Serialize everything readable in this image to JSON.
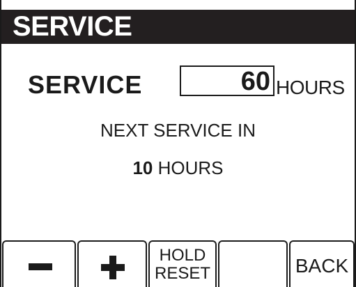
{
  "header": {
    "title": "SERVICE"
  },
  "setting": {
    "label": "SERVICE",
    "value": "60",
    "unit": "HOURS"
  },
  "status": {
    "line1": "NEXT SERVICE IN",
    "remaining_value": "10",
    "remaining_unit": "HOURS"
  },
  "softkeys": {
    "decrease_icon": "minus-icon",
    "increase_icon": "plus-icon",
    "hold_reset_line1": "HOLD",
    "hold_reset_line2": "RESET",
    "back_label": "BACK"
  },
  "colors": {
    "title_bar_background": "#231f20",
    "title_text": "#ffffff",
    "foreground": "#1a1a1a",
    "background": "#ffffff"
  }
}
